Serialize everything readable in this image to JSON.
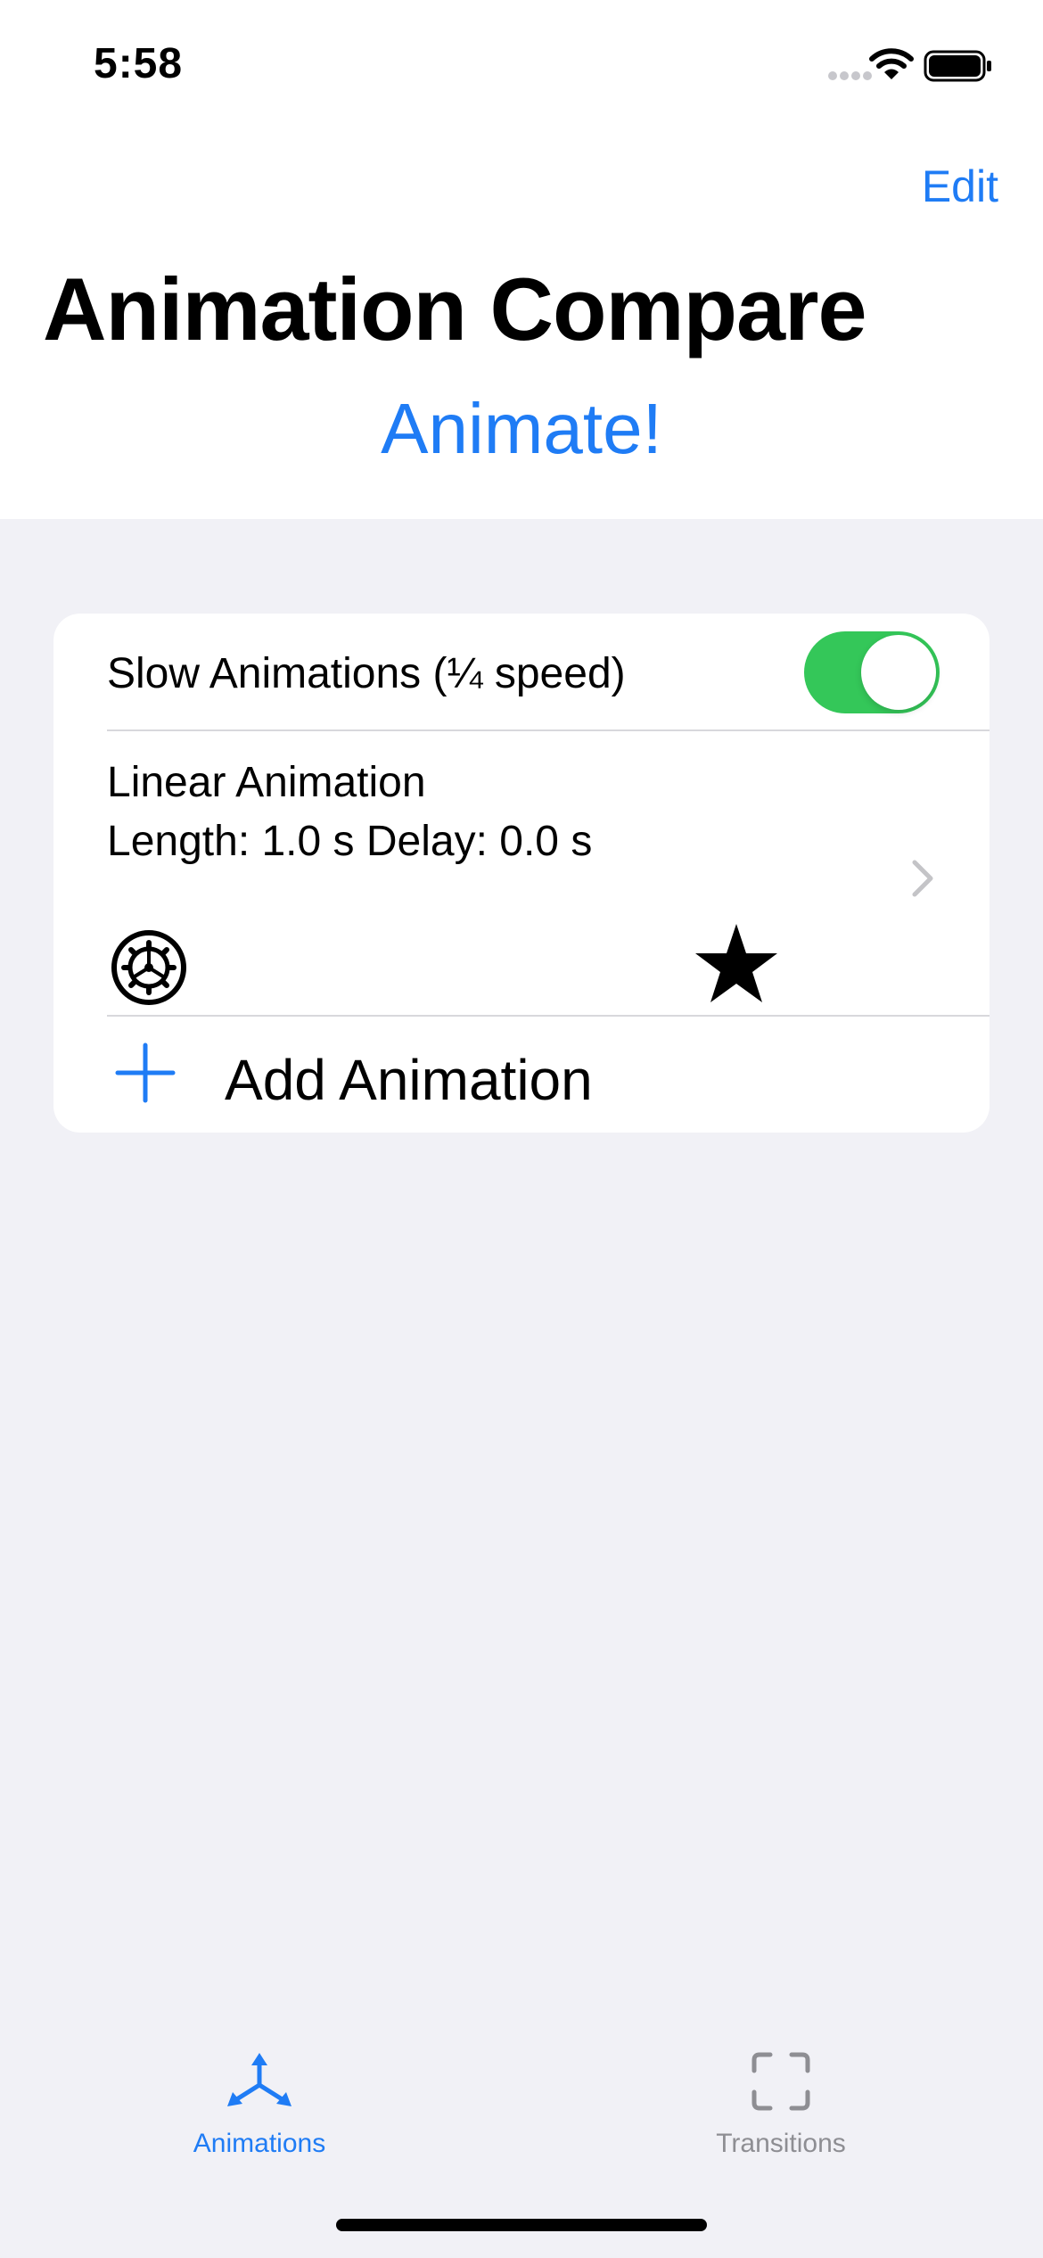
{
  "status_bar": {
    "time": "5:58",
    "icons": [
      "cellular-signal-icon",
      "wifi-icon",
      "battery-icon"
    ]
  },
  "nav": {
    "edit_label": "Edit",
    "title": "Animation Compare",
    "animate_label": "Animate!"
  },
  "settings": {
    "slow_label": "Slow Animations (¼ speed)",
    "slow_enabled": true
  },
  "animations": [
    {
      "name": "Linear Animation",
      "detail": "Length: 1.0 s Delay: 0.0 s",
      "icons": [
        "gear-icon",
        "star-icon"
      ]
    }
  ],
  "add_animation_label": "Add Animation",
  "tabs": [
    {
      "label": "Animations",
      "icon": "animations-icon",
      "selected": true
    },
    {
      "label": "Transitions",
      "icon": "transitions-icon",
      "selected": false
    }
  ],
  "colors": {
    "accent": "#1F7CF5",
    "toggle_on": "#34C759",
    "background": "#F1F1F6",
    "tab_inactive": "#8E8E93"
  }
}
